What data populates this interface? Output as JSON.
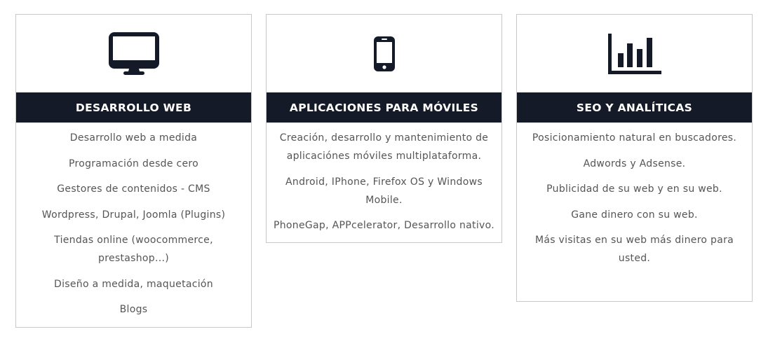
{
  "colors": {
    "header_bg": "#141a28",
    "icon": "#141a28",
    "border": "#c9c9c9",
    "text": "#555555"
  },
  "services": [
    {
      "icon": "desktop-monitor-icon",
      "title": "DESARROLLO WEB",
      "items": [
        "Desarrollo web a medida",
        "Programación desde cero",
        "Gestores de contenidos - CMS",
        "Wordpress, Drupal, Joomla (Plugins)",
        "Tiendas online (woocommerce, prestashop...)",
        "Diseño a medida, maquetación",
        "Blogs"
      ]
    },
    {
      "icon": "mobile-phone-icon",
      "title": "APLICACIONES PARA MÓVILES",
      "items": [
        "Creación, desarrollo y mantenimiento de aplicaciónes móviles multiplataforma.",
        "Android, IPhone, Firefox OS y Windows Mobile.",
        "PhoneGap, APPcelerator, Desarrollo nativo."
      ]
    },
    {
      "icon": "bar-chart-icon",
      "title": "SEO Y ANALÍTICAS",
      "items": [
        "Posicionamiento natural en buscadores.",
        "Adwords y Adsense.",
        "Publicidad de su web y en su web.",
        "Gane dinero con su web.",
        "Más visitas en su web más dinero para usted."
      ]
    }
  ]
}
